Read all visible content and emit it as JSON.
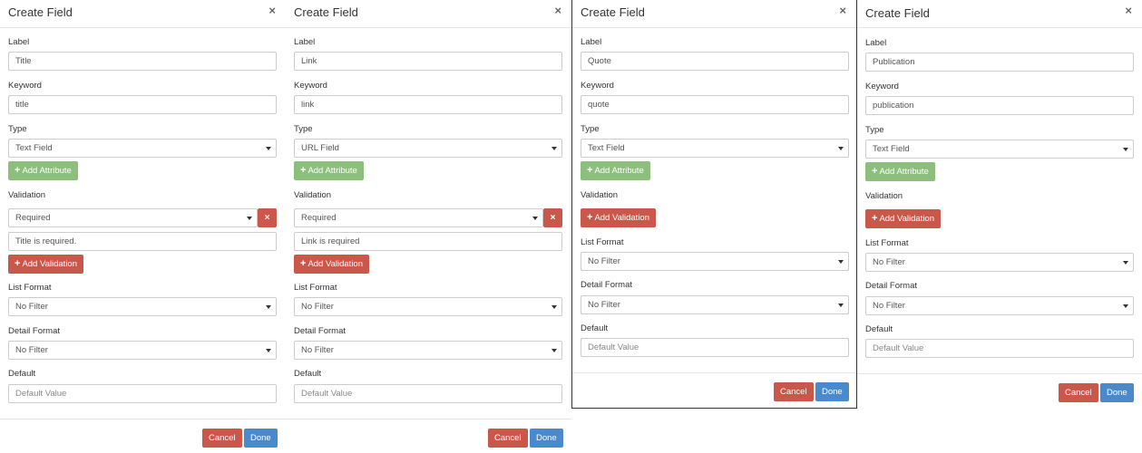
{
  "dialogs": [
    {
      "title": "Create Field",
      "close": "×",
      "label": {
        "label": "Label",
        "value": "Title"
      },
      "keyword": {
        "label": "Keyword",
        "value": "title"
      },
      "type": {
        "label": "Type",
        "value": "Text Field"
      },
      "add_attribute": "Add Attribute",
      "validation_label": "Validation",
      "validation": {
        "rule": "Required",
        "remove": "×",
        "message": "Title is required."
      },
      "add_validation": "Add Validation",
      "list_format": {
        "label": "List Format",
        "value": "No Filter"
      },
      "detail_format": {
        "label": "Detail Format",
        "value": "No Filter"
      },
      "default": {
        "label": "Default",
        "placeholder": "Default Value"
      },
      "cancel": "Cancel",
      "done": "Done"
    },
    {
      "title": "Create Field",
      "close": "×",
      "label": {
        "label": "Label",
        "value": "Link"
      },
      "keyword": {
        "label": "Keyword",
        "value": "link"
      },
      "type": {
        "label": "Type",
        "value": "URL Field"
      },
      "add_attribute": "Add Attribute",
      "validation_label": "Validation",
      "validation": {
        "rule": "Required",
        "remove": "×",
        "message": "Link is required"
      },
      "add_validation": "Add Validation",
      "list_format": {
        "label": "List Format",
        "value": "No Filter"
      },
      "detail_format": {
        "label": "Detail Format",
        "value": "No Filter"
      },
      "default": {
        "label": "Default",
        "placeholder": "Default Value"
      },
      "cancel": "Cancel",
      "done": "Done"
    },
    {
      "title": "Create Field",
      "close": "×",
      "label": {
        "label": "Label",
        "value": "Quote"
      },
      "keyword": {
        "label": "Keyword",
        "value": "quote"
      },
      "type": {
        "label": "Type",
        "value": "Text Field"
      },
      "add_attribute": "Add Attribute",
      "validation_label": "Validation",
      "add_validation": "Add Validation",
      "list_format": {
        "label": "List Format",
        "value": "No Filter"
      },
      "detail_format": {
        "label": "Detail Format",
        "value": "No Filter"
      },
      "default": {
        "label": "Default",
        "placeholder": "Default Value"
      },
      "cancel": "Cancel",
      "done": "Done"
    },
    {
      "title": "Create Field",
      "close": "×",
      "label": {
        "label": "Label",
        "value": "Publication"
      },
      "keyword": {
        "label": "Keyword",
        "value": "publication"
      },
      "type": {
        "label": "Type",
        "value": "Text Field"
      },
      "add_attribute": "Add Attribute",
      "validation_label": "Validation",
      "add_validation": "Add Validation",
      "list_format": {
        "label": "List Format",
        "value": "No Filter"
      },
      "detail_format": {
        "label": "Detail Format",
        "value": "No Filter"
      },
      "default": {
        "label": "Default",
        "placeholder": "Default Value"
      },
      "cancel": "Cancel",
      "done": "Done"
    }
  ],
  "colors": {
    "add_attribute": "#8cbf7b",
    "danger": "#c9574a",
    "primary": "#4a89cc"
  },
  "icons": {
    "plus": "plus-icon",
    "close": "close-icon",
    "remove": "remove-icon",
    "caret": "caret-down-icon"
  }
}
